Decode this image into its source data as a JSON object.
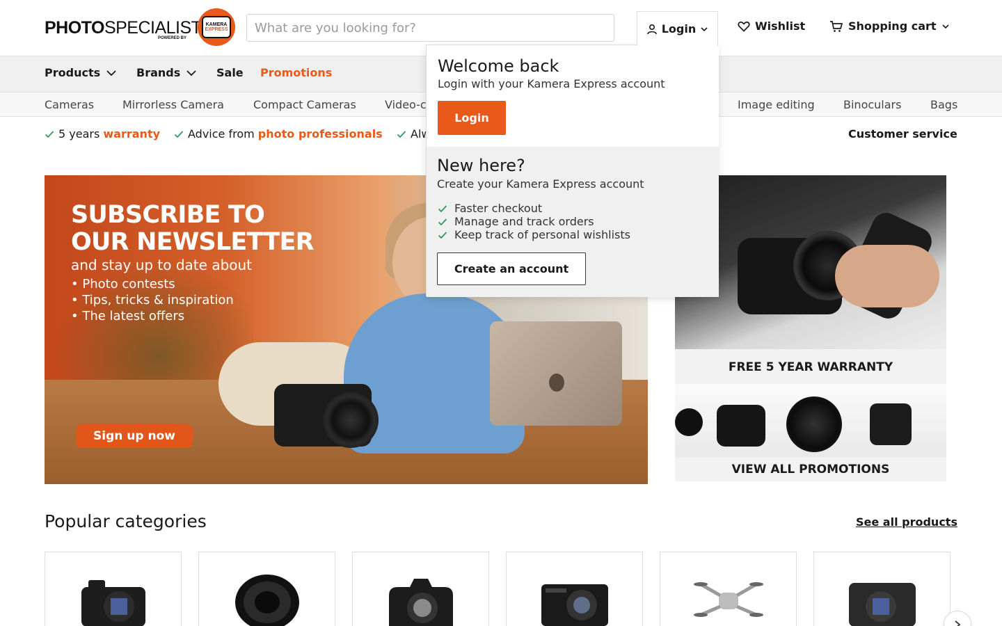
{
  "brand": {
    "logo_text_bold": "PHOTO",
    "logo_text_regular": "SPECIALIST",
    "logo_powered_by": "POWERED BY",
    "badge_line1": "KAMERA",
    "badge_line2": "EXPRESS",
    "accent_color": "#e8591a"
  },
  "header": {
    "search_placeholder": "What are you looking for?",
    "login_label": "Login",
    "wishlist_label": "Wishlist",
    "cart_label": "Shopping cart",
    "icons": [
      "user-icon",
      "chevron-down-icon",
      "heart-icon",
      "cart-icon"
    ]
  },
  "nav": {
    "items": [
      {
        "label": "Products",
        "dropdown": true
      },
      {
        "label": "Brands",
        "dropdown": true
      },
      {
        "label": "Sale",
        "dropdown": false
      },
      {
        "label": "Promotions",
        "dropdown": false
      }
    ]
  },
  "subnav": {
    "items": [
      "Cameras",
      "Mirrorless Camera",
      "Compact Cameras",
      "Video-c",
      "Image editing",
      "Binoculars",
      "Bags"
    ]
  },
  "usps": [
    {
      "text": "5 years ",
      "highlight": "warranty"
    },
    {
      "text": "Advice from ",
      "highlight": "photo professionals"
    },
    {
      "text": "Alw",
      "highlight": ""
    }
  ],
  "customer_service": "Customer service",
  "hero": {
    "title": "SUBSCRIBE TO\nOUR NEWSLETTER",
    "subtitle": "and stay up to date about",
    "bullets": [
      "Photo contests",
      "Tips, tricks & inspiration",
      "The latest offers"
    ],
    "cta": "Sign up now"
  },
  "promos": [
    {
      "label": "FREE 5 YEAR WARRANTY"
    },
    {
      "label": "VIEW ALL PROMOTIONS"
    }
  ],
  "popular": {
    "title": "Popular categories",
    "see_all": "See all products"
  },
  "login_dropdown": {
    "welcome_title": "Welcome back",
    "welcome_text": "Login with your Kamera Express account",
    "login_button": "Login",
    "new_title": "New here?",
    "new_text": "Create your Kamera Express account",
    "benefits": [
      "Faster checkout",
      "Manage and track orders",
      "Keep track of personal wishlists"
    ],
    "create_button": "Create an account"
  }
}
